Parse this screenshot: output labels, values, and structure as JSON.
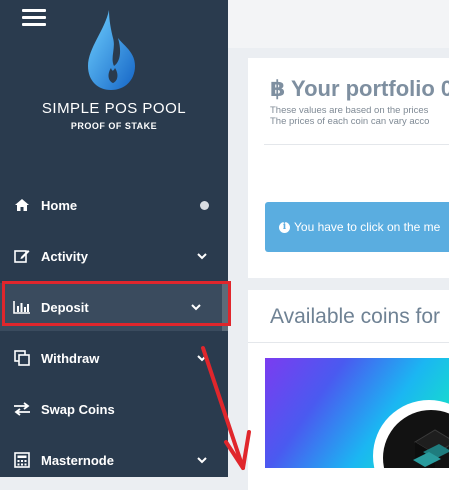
{
  "brand": {
    "title": "SIMPLE POS POOL",
    "subtitle": "PROOF OF STAKE",
    "logo_icon": "water-drop-logo"
  },
  "sidebar": {
    "menu_icon": "hamburger-icon",
    "items": [
      {
        "label": "Home",
        "icon": "home-icon",
        "indicator": "dot"
      },
      {
        "label": "Activity",
        "icon": "edit-icon",
        "indicator": "chevron-down"
      },
      {
        "label": "Deposit",
        "icon": "bar-chart-icon",
        "indicator": "chevron-down",
        "active": true
      },
      {
        "label": "Withdraw",
        "icon": "copy-icon",
        "indicator": "chevron-down"
      },
      {
        "label": "Swap Coins",
        "icon": "exchange-icon",
        "indicator": "none"
      },
      {
        "label": "Masternode",
        "icon": "calculator-icon",
        "indicator": "chevron-down"
      }
    ]
  },
  "portfolio": {
    "title": "Your portfolio 0.",
    "currency_icon": "bitcoin-icon",
    "note_line1": "These values are based on the prices",
    "note_line2": "The prices of each coin can vary acco",
    "alert_text": "You have to click on the me"
  },
  "coins": {
    "title": "Available coins for"
  },
  "colors": {
    "sidebar_bg": "#2a3b4e",
    "highlight": "#e0262c",
    "alert_bg": "#5aade0",
    "heading": "#7e8fa0",
    "annotation_arrow": "#e0262c"
  }
}
